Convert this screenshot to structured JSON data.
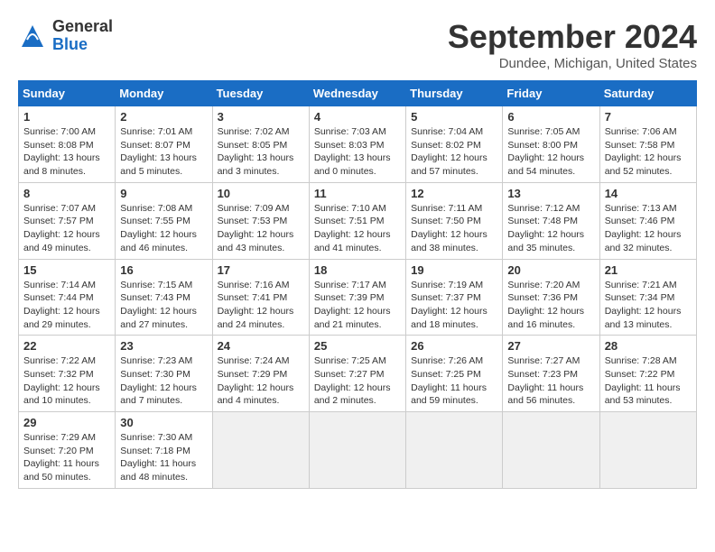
{
  "header": {
    "logo_general": "General",
    "logo_blue": "Blue",
    "month_title": "September 2024",
    "location": "Dundee, Michigan, United States"
  },
  "days_of_week": [
    "Sunday",
    "Monday",
    "Tuesday",
    "Wednesday",
    "Thursday",
    "Friday",
    "Saturday"
  ],
  "weeks": [
    [
      {
        "day": 1,
        "sunrise": "7:00 AM",
        "sunset": "8:08 PM",
        "daylight": "13 hours and 8 minutes."
      },
      {
        "day": 2,
        "sunrise": "7:01 AM",
        "sunset": "8:07 PM",
        "daylight": "13 hours and 5 minutes."
      },
      {
        "day": 3,
        "sunrise": "7:02 AM",
        "sunset": "8:05 PM",
        "daylight": "13 hours and 3 minutes."
      },
      {
        "day": 4,
        "sunrise": "7:03 AM",
        "sunset": "8:03 PM",
        "daylight": "13 hours and 0 minutes."
      },
      {
        "day": 5,
        "sunrise": "7:04 AM",
        "sunset": "8:02 PM",
        "daylight": "12 hours and 57 minutes."
      },
      {
        "day": 6,
        "sunrise": "7:05 AM",
        "sunset": "8:00 PM",
        "daylight": "12 hours and 54 minutes."
      },
      {
        "day": 7,
        "sunrise": "7:06 AM",
        "sunset": "7:58 PM",
        "daylight": "12 hours and 52 minutes."
      }
    ],
    [
      {
        "day": 8,
        "sunrise": "7:07 AM",
        "sunset": "7:57 PM",
        "daylight": "12 hours and 49 minutes."
      },
      {
        "day": 9,
        "sunrise": "7:08 AM",
        "sunset": "7:55 PM",
        "daylight": "12 hours and 46 minutes."
      },
      {
        "day": 10,
        "sunrise": "7:09 AM",
        "sunset": "7:53 PM",
        "daylight": "12 hours and 43 minutes."
      },
      {
        "day": 11,
        "sunrise": "7:10 AM",
        "sunset": "7:51 PM",
        "daylight": "12 hours and 41 minutes."
      },
      {
        "day": 12,
        "sunrise": "7:11 AM",
        "sunset": "7:50 PM",
        "daylight": "12 hours and 38 minutes."
      },
      {
        "day": 13,
        "sunrise": "7:12 AM",
        "sunset": "7:48 PM",
        "daylight": "12 hours and 35 minutes."
      },
      {
        "day": 14,
        "sunrise": "7:13 AM",
        "sunset": "7:46 PM",
        "daylight": "12 hours and 32 minutes."
      }
    ],
    [
      {
        "day": 15,
        "sunrise": "7:14 AM",
        "sunset": "7:44 PM",
        "daylight": "12 hours and 29 minutes."
      },
      {
        "day": 16,
        "sunrise": "7:15 AM",
        "sunset": "7:43 PM",
        "daylight": "12 hours and 27 minutes."
      },
      {
        "day": 17,
        "sunrise": "7:16 AM",
        "sunset": "7:41 PM",
        "daylight": "12 hours and 24 minutes."
      },
      {
        "day": 18,
        "sunrise": "7:17 AM",
        "sunset": "7:39 PM",
        "daylight": "12 hours and 21 minutes."
      },
      {
        "day": 19,
        "sunrise": "7:19 AM",
        "sunset": "7:37 PM",
        "daylight": "12 hours and 18 minutes."
      },
      {
        "day": 20,
        "sunrise": "7:20 AM",
        "sunset": "7:36 PM",
        "daylight": "12 hours and 16 minutes."
      },
      {
        "day": 21,
        "sunrise": "7:21 AM",
        "sunset": "7:34 PM",
        "daylight": "12 hours and 13 minutes."
      }
    ],
    [
      {
        "day": 22,
        "sunrise": "7:22 AM",
        "sunset": "7:32 PM",
        "daylight": "12 hours and 10 minutes."
      },
      {
        "day": 23,
        "sunrise": "7:23 AM",
        "sunset": "7:30 PM",
        "daylight": "12 hours and 7 minutes."
      },
      {
        "day": 24,
        "sunrise": "7:24 AM",
        "sunset": "7:29 PM",
        "daylight": "12 hours and 4 minutes."
      },
      {
        "day": 25,
        "sunrise": "7:25 AM",
        "sunset": "7:27 PM",
        "daylight": "12 hours and 2 minutes."
      },
      {
        "day": 26,
        "sunrise": "7:26 AM",
        "sunset": "7:25 PM",
        "daylight": "11 hours and 59 minutes."
      },
      {
        "day": 27,
        "sunrise": "7:27 AM",
        "sunset": "7:23 PM",
        "daylight": "11 hours and 56 minutes."
      },
      {
        "day": 28,
        "sunrise": "7:28 AM",
        "sunset": "7:22 PM",
        "daylight": "11 hours and 53 minutes."
      }
    ],
    [
      {
        "day": 29,
        "sunrise": "7:29 AM",
        "sunset": "7:20 PM",
        "daylight": "11 hours and 50 minutes."
      },
      {
        "day": 30,
        "sunrise": "7:30 AM",
        "sunset": "7:18 PM",
        "daylight": "11 hours and 48 minutes."
      },
      null,
      null,
      null,
      null,
      null
    ]
  ]
}
